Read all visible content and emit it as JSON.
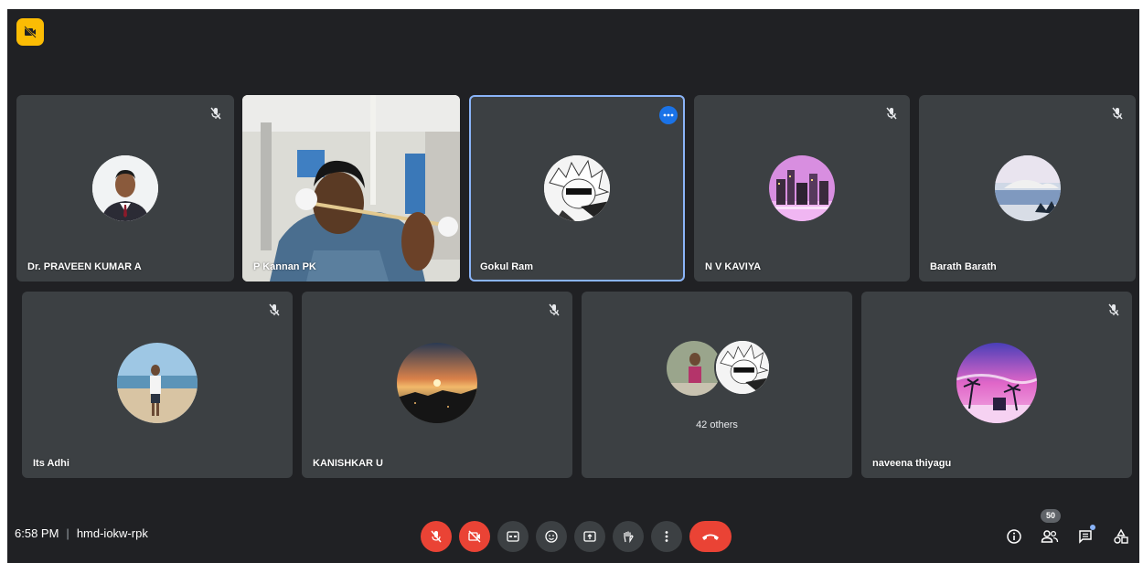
{
  "participants_row1": [
    {
      "name": "Dr. PRAVEEN KUMAR A",
      "muted": true
    },
    {
      "name": "P Kannan PK",
      "muted": false,
      "video": true
    },
    {
      "name": "Gokul Ram",
      "muted": false,
      "active": true
    },
    {
      "name": "N V KAVIYA",
      "muted": true
    },
    {
      "name": "Barath Barath",
      "muted": true
    }
  ],
  "participants_row2": [
    {
      "name": "Its Adhi",
      "muted": true
    },
    {
      "name": "KANISHKAR U",
      "muted": true
    },
    {
      "name": "",
      "others_label": "42 others"
    },
    {
      "name": "naveena thiyagu",
      "muted": true
    }
  ],
  "meeting": {
    "time": "6:58 PM",
    "separator": "|",
    "code": "hmd-iokw-rpk"
  },
  "participants_count": "50",
  "colors": {
    "background": "#202124",
    "tile": "#3c4043",
    "red": "#ea4335",
    "accent": "#8ab4f8",
    "yellow": "#fbbc04"
  },
  "controls": [
    "mic-off-icon",
    "camera-off-icon",
    "captions-icon",
    "emoji-icon",
    "present-icon",
    "raise-hand-icon",
    "more-options-icon",
    "end-call-icon"
  ],
  "right_controls": [
    "info-icon",
    "people-icon",
    "chat-icon",
    "activities-icon"
  ]
}
